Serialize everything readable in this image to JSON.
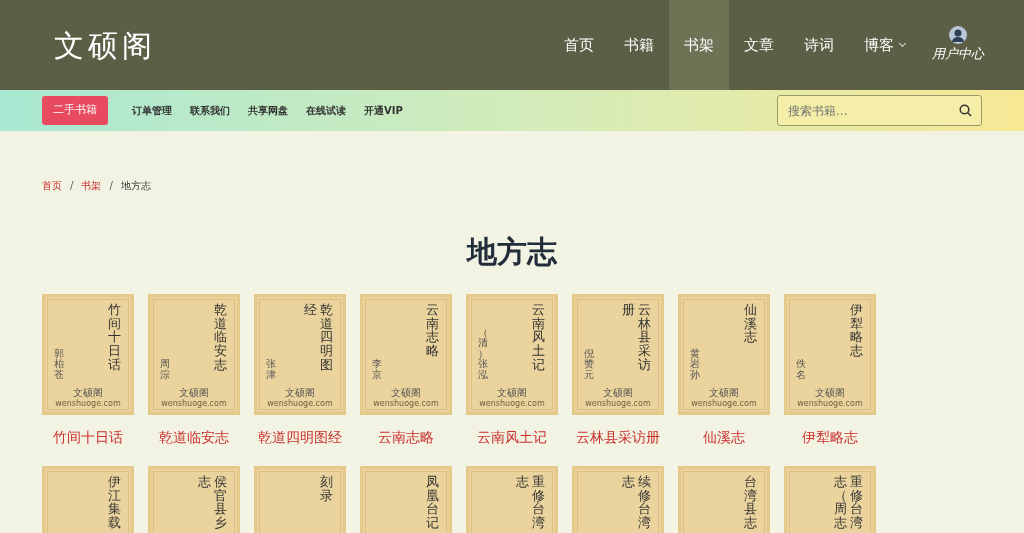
{
  "logo": "文硕阁",
  "nav": [
    {
      "label": "首页",
      "selected": false
    },
    {
      "label": "书籍",
      "selected": false
    },
    {
      "label": "书架",
      "selected": true
    },
    {
      "label": "文章",
      "selected": false
    },
    {
      "label": "诗词",
      "selected": false
    },
    {
      "label": "博客",
      "selected": false,
      "dropdown": true
    }
  ],
  "user": {
    "label": "用户中心"
  },
  "subnav": {
    "button": "二手书籍",
    "links": [
      "订单管理",
      "联系我们",
      "共享网盘",
      "在线试读",
      "开通VIP"
    ],
    "search": {
      "placeholder": "搜索书籍..."
    }
  },
  "breadcrumb": {
    "separator": "/",
    "items": [
      {
        "label": "首页",
        "current": false
      },
      {
        "label": "书架",
        "current": false
      },
      {
        "label": "地方志",
        "current": true
      }
    ]
  },
  "heading": "地方志",
  "books": [
    {
      "cover_title": [
        "竹间十日话"
      ],
      "author": "郭柏苍",
      "publisher": "文硕阁",
      "site": "wenshuoge.com",
      "label": "竹间十日话"
    },
    {
      "cover_title": [
        "乾道临安志"
      ],
      "author": "周淙",
      "publisher": "文硕阁",
      "site": "wenshuoge.com",
      "label": "乾道临安志"
    },
    {
      "cover_title": [
        "经",
        "乾道四明图"
      ],
      "author": "张津",
      "publisher": "文硕阁",
      "site": "wenshuoge.com",
      "label": "乾道四明图经"
    },
    {
      "cover_title": [
        "云南志略"
      ],
      "author": "李京",
      "publisher": "文硕阁",
      "site": "wenshuoge.com",
      "label": "云南志略"
    },
    {
      "cover_title": [
        "云南风土记"
      ],
      "author": "（清）张泓",
      "publisher": "文硕阁",
      "site": "wenshuoge.com",
      "label": "云南风土记"
    },
    {
      "cover_title": [
        "册",
        "云林县采访"
      ],
      "author": "倪赞元",
      "publisher": "文硕阁",
      "site": "wenshuoge.com",
      "label": "云林县采访册"
    },
    {
      "cover_title": [
        "仙溪志"
      ],
      "author": "黄岩孙",
      "publisher": "文硕阁",
      "site": "wenshuoge.com",
      "label": "仙溪志"
    },
    {
      "cover_title": [
        "伊犁略志"
      ],
      "author": "佚名",
      "publisher": "文硕阁",
      "site": "wenshuoge.com",
      "label": "伊犁略志"
    },
    {
      "cover_title": [
        "伊江集载"
      ]
    },
    {
      "cover_title": [
        "志",
        "侯官县乡"
      ]
    },
    {
      "cover_title": [
        "刻录"
      ]
    },
    {
      "cover_title": [
        "凤凰台记"
      ]
    },
    {
      "cover_title": [
        "志",
        "重修台湾"
      ]
    },
    {
      "cover_title": [
        "志",
        "续修台湾"
      ]
    },
    {
      "cover_title": [
        "台湾县志"
      ]
    },
    {
      "cover_title": [
        "志（周志",
        "重修台湾"
      ]
    }
  ]
}
